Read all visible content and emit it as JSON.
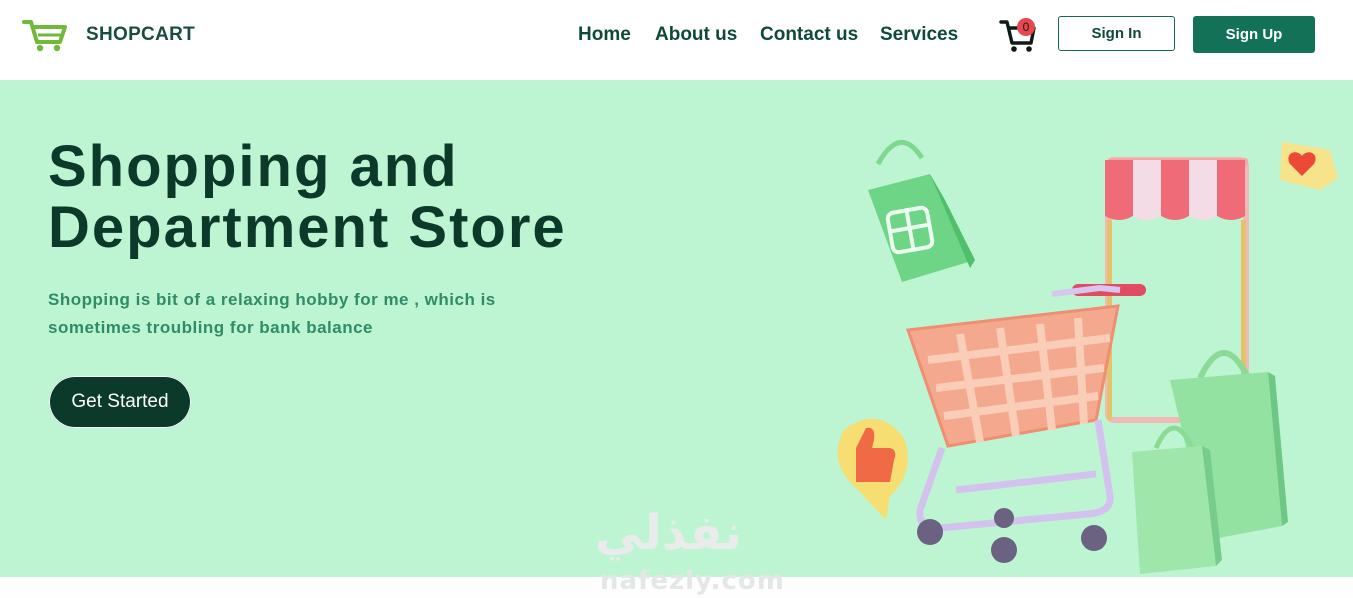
{
  "header": {
    "brand": "SHOPCART",
    "logo_icon": "shopping-cart-logo",
    "nav": [
      "Home",
      "About us",
      "Contact us",
      "Services"
    ],
    "cart_icon": "cart-icon",
    "cart_count": "0",
    "signin_label": "Sign In",
    "signup_label": "Sign Up"
  },
  "hero": {
    "title_line1": "Shopping and",
    "title_line2": "Department Store",
    "subtitle_line1": "Shopping is bit of a relaxing hobby for me , which is",
    "subtitle_line2": "sometimes troubling for bank balance",
    "cta_label": "Get Started",
    "illustration": [
      "shopping-cart-3d",
      "gift-bag-icon",
      "shop-awning",
      "heart-bubble-icon",
      "thumbs-up-bubble-icon",
      "shopping-bags"
    ]
  },
  "watermark": {
    "arabic": "نفذلي",
    "latin": "nafezly.com"
  },
  "colors": {
    "hero_bg": "#bdf5d2",
    "primary": "#137157",
    "dark_green": "#0b3a2b",
    "badge": "#e8474f"
  }
}
